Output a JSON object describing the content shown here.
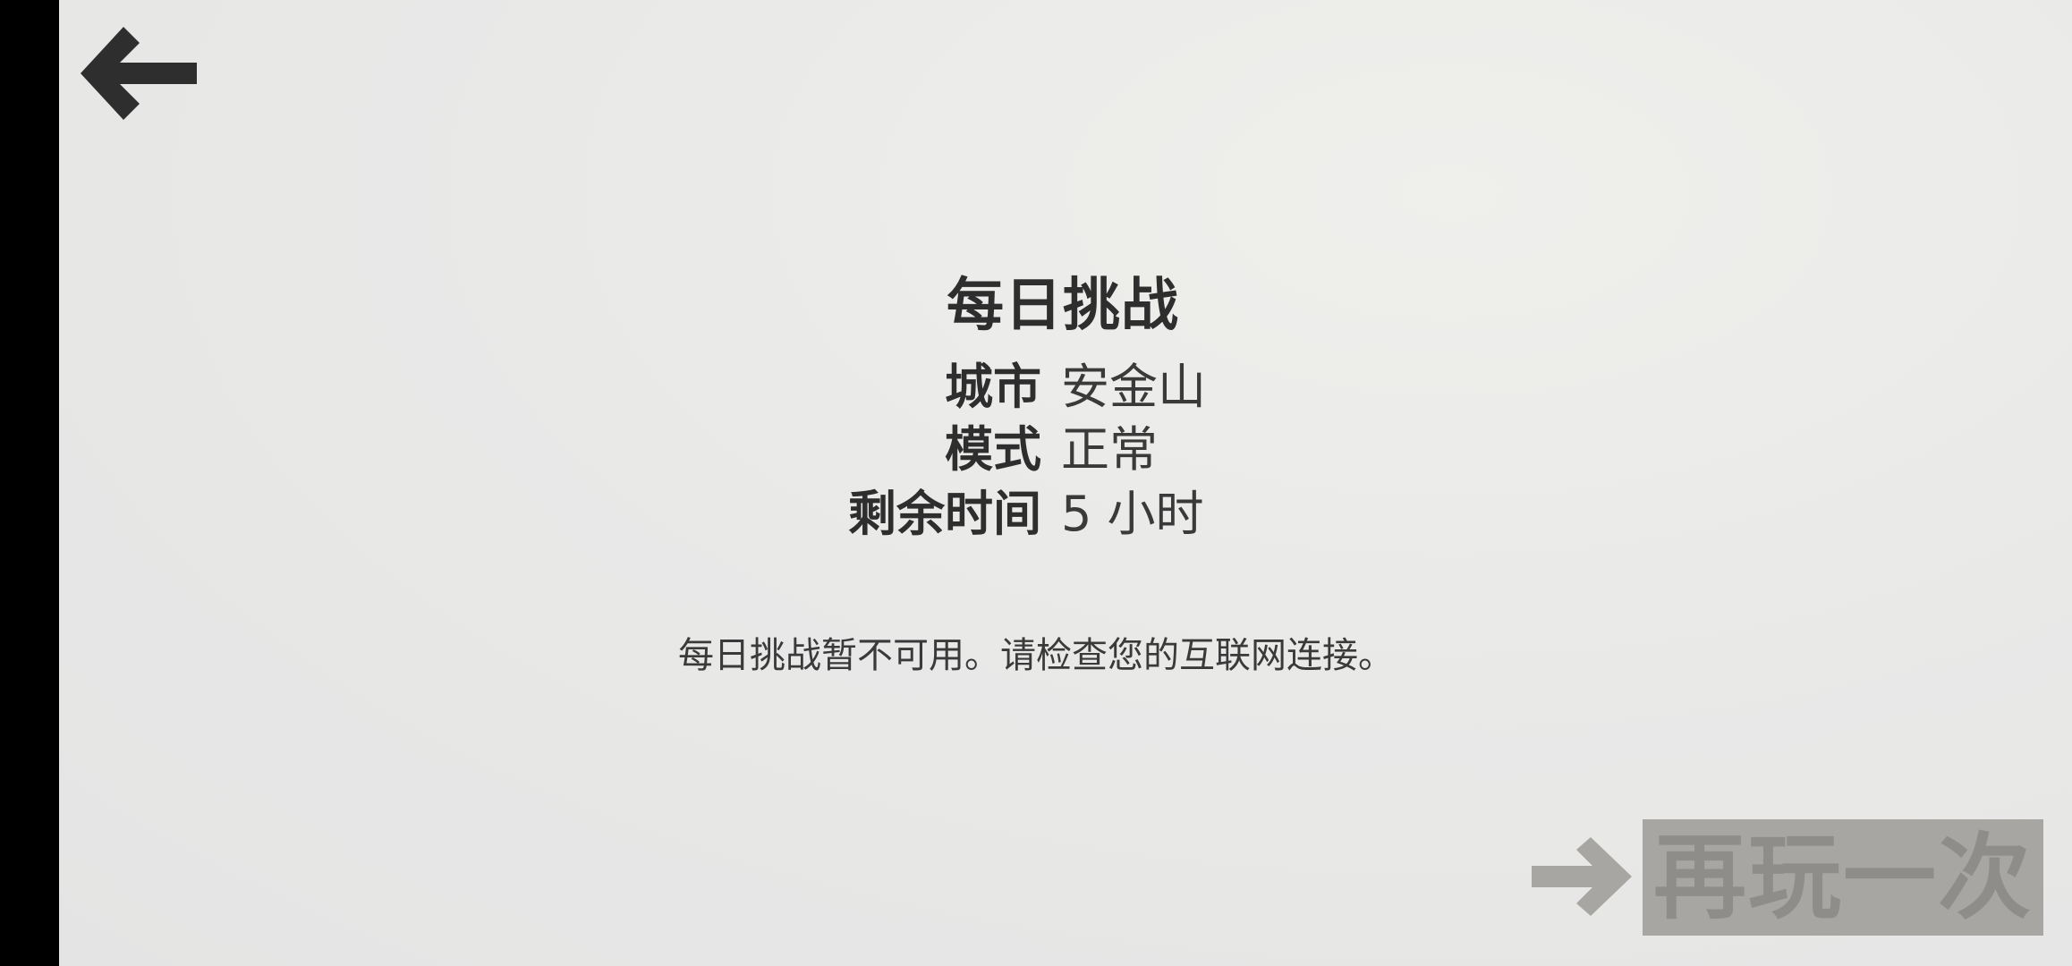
{
  "nav": {
    "back_icon": "arrow-left-icon"
  },
  "challenge": {
    "title": "每日挑战",
    "city_label": "城市",
    "city_value": "安金山",
    "mode_label": "模式",
    "mode_value": "正常",
    "time_label": "剩余时间",
    "time_value": "5 小时"
  },
  "message": "每日挑战暂不可用。请检查您的互联网连接。",
  "replay": {
    "icon": "arrow-right-icon",
    "label": "再玩一次"
  },
  "colors": {
    "text": "#2e2e2e",
    "sidebar": "#000000",
    "button_bg": "#a8a6a2",
    "button_text": "#8f8d8a"
  }
}
